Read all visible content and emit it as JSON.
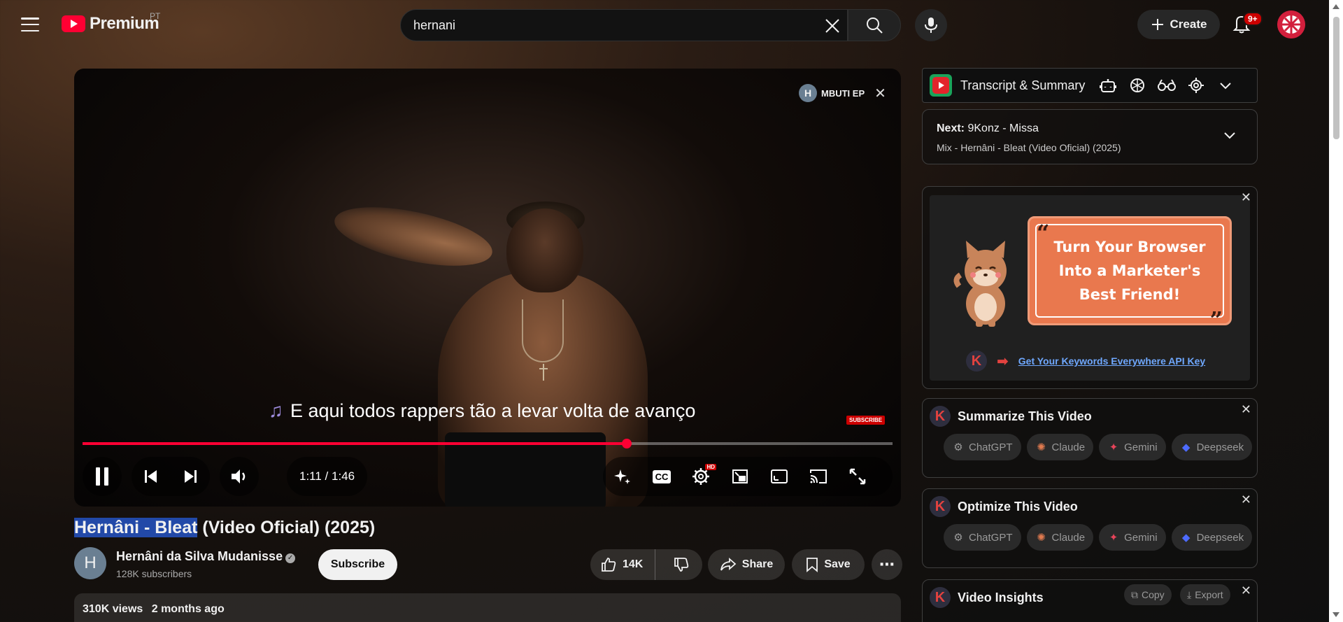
{
  "header": {
    "logo_text": "Premium",
    "country_code": "PT",
    "search_value": "hernani",
    "create_label": "Create",
    "notification_badge": "9+"
  },
  "player": {
    "overlay_channel_initial": "H",
    "overlay_channel_name": "MBUTI EP",
    "caption_text": "E aqui todos rappers tão a levar volta de avanço",
    "watermark_text": "SUBSCRIBE",
    "time_display": "1:11 / 1:46",
    "progress_fraction": 0.672,
    "cc_label": "CC",
    "hd_badge": "HD",
    "accent_color": "#ff0033"
  },
  "video": {
    "title_highlighted": "Hernâni - Bleat",
    "title_rest": " (Video Oficial) (2025)",
    "channel_initial": "H",
    "channel_name": "Hernâni da Silva Mudanisse",
    "subscribers": "128K subscribers",
    "subscribe_label": "Subscribe",
    "likes": "14K",
    "share_label": "Share",
    "save_label": "Save",
    "views": "310K views",
    "age": "2 months ago"
  },
  "sidebar": {
    "transcript_title": "Transcript & Summary",
    "next_label": "Next:",
    "next_title": "9Konz - Missa",
    "next_playlist": "Mix - Hernâni - Bleat (Video Oficial) (2025)",
    "ad": {
      "line1": "Turn Your Browser",
      "line2": "Into a Marketer's",
      "line3": "Best Friend!",
      "link_text": "Get Your Keywords Everywhere API Key",
      "k_letter": "K"
    },
    "summarize_title": "Summarize This Video",
    "optimize_title": "Optimize This Video",
    "insights_title": "Video Insights",
    "copy_label": "Copy",
    "export_label": "Export",
    "ai_tools": [
      "ChatGPT",
      "Claude",
      "Gemini",
      "Deepseek"
    ]
  }
}
